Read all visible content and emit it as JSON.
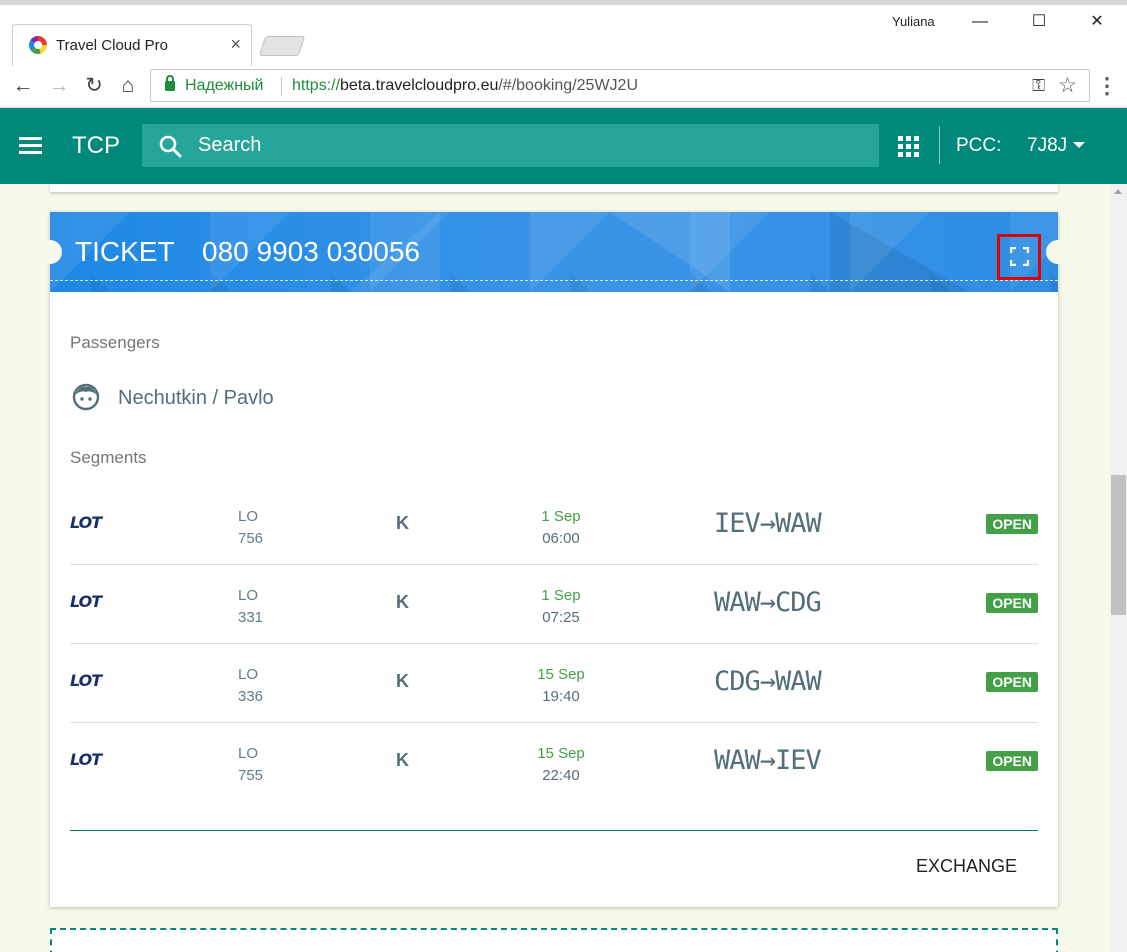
{
  "browser": {
    "tab_title": "Travel Cloud Pro",
    "tab_close": "×",
    "user_name": "Yuliana",
    "secure_label": "Надежный",
    "url_scheme": "https://",
    "url_host": "beta.travelcloudpro.eu",
    "url_path": "/#/booking/25WJ2U"
  },
  "appbar": {
    "title": "TCP",
    "search_placeholder": "Search",
    "pcc_label": "PCC:",
    "pcc_value": "7J8J"
  },
  "ticket": {
    "label": "TICKET",
    "number": "080 9903 030056",
    "passengers_label": "Passengers",
    "passenger_name": "Nechutkin / Pavlo",
    "segments_label": "Segments",
    "segments": [
      {
        "airline": "LOT",
        "carrier": "LO",
        "flight": "756",
        "class": "K",
        "date": "1 Sep",
        "time": "06:00",
        "route": "IEV→WAW",
        "status": "OPEN"
      },
      {
        "airline": "LOT",
        "carrier": "LO",
        "flight": "331",
        "class": "K",
        "date": "1 Sep",
        "time": "07:25",
        "route": "WAW→CDG",
        "status": "OPEN"
      },
      {
        "airline": "LOT",
        "carrier": "LO",
        "flight": "336",
        "class": "K",
        "date": "15 Sep",
        "time": "19:40",
        "route": "CDG→WAW",
        "status": "OPEN"
      },
      {
        "airline": "LOT",
        "carrier": "LO",
        "flight": "755",
        "class": "K",
        "date": "15 Sep",
        "time": "22:40",
        "route": "WAW→IEV",
        "status": "OPEN"
      }
    ],
    "exchange_label": "EXCHANGE"
  },
  "colors": {
    "header": "#00897b",
    "ticket_header": "#1e88e5",
    "status_open": "#43a047",
    "highlight": "#e00000"
  }
}
